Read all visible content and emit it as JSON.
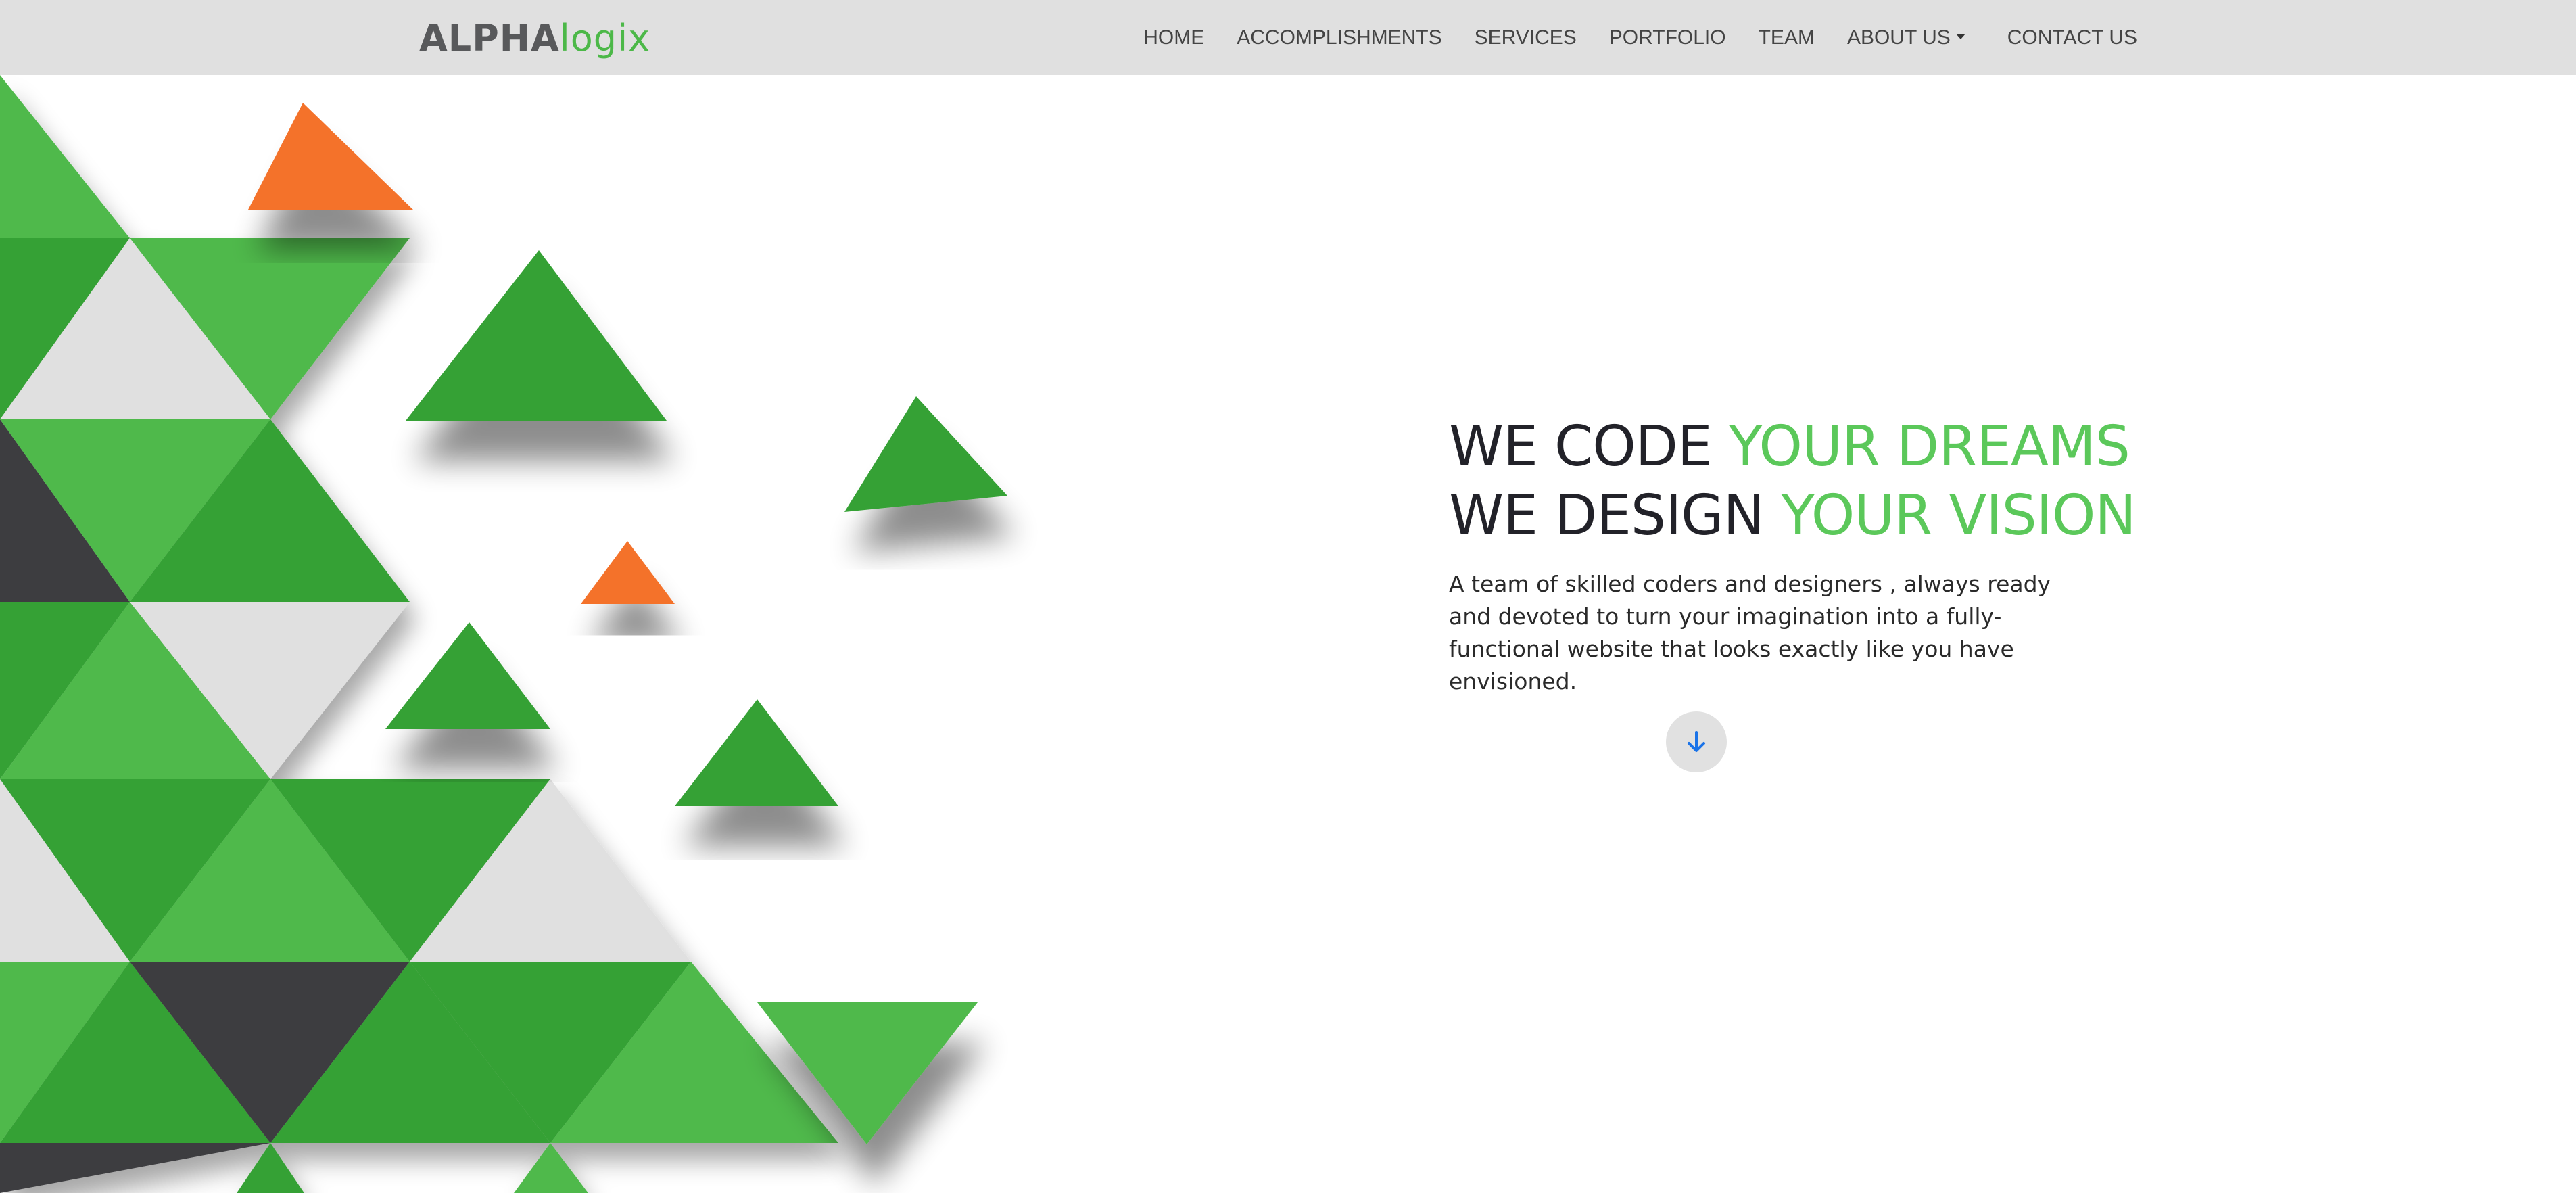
{
  "brand": {
    "part1": "ALPHA",
    "part2": "logix"
  },
  "nav": {
    "items": [
      "HOME",
      "ACCOMPLISHMENTS",
      "SERVICES",
      "PORTFOLIO",
      "TEAM"
    ],
    "about": "ABOUT US",
    "contact": "CONTACT US"
  },
  "hero": {
    "line1_dark": "WE CODE",
    "line1_green": "YOUR DREAMS",
    "line2_dark": "WE DESIGN",
    "line2_green": "YOUR VISION",
    "description": "A team of skilled coders and designers , always ready and devoted to turn your imagination into a fully-functional website that looks exactly like you have envisioned.",
    "scroll_icon": "arrow-down-icon"
  },
  "colors": {
    "navbar_bg": "#e0e0e0",
    "brand_green": "#4cb848",
    "headline_green": "#5bc85a",
    "triangle_green": "#35a134",
    "triangle_light_green": "#4fb94c",
    "triangle_orange": "#f4722b",
    "triangle_gray": "#e0e0e0",
    "triangle_dark": "#3d3d40",
    "scroll_arrow": "#1a73e8"
  }
}
